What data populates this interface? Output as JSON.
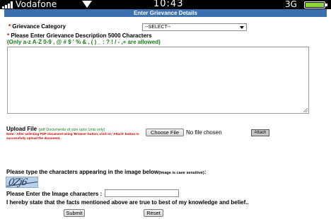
{
  "status_bar": {
    "carrier": "Vodafone",
    "time": "10:43",
    "network": "3G",
    "colors": {
      "battery": "#8cd63a"
    }
  },
  "header": {
    "title": "Enter Grievance Details",
    "color": "#3b6fad"
  },
  "form": {
    "category": {
      "required_mark": "*",
      "label": "Grievance Category",
      "selected": "--SELECT--"
    },
    "description": {
      "required_mark": "*",
      "label": "Please Enter Grievance Description 5000 Characters",
      "hint": "(Only a-z A-Z 0-9 , @ # $ ' % & , ( ) _ : ? ! / - ,+ are allowed)",
      "value": ""
    },
    "upload": {
      "label": "Upload File",
      "label_note": "(pdf Documents of size upto 1mb only)",
      "note": "Note:- After selecting PDF document using 'Browse' button, click on 'Attach' button to successfully upload the document.",
      "choose_button": "Choose File",
      "file_status": "No file chosen",
      "attach_button": "Attach"
    },
    "captcha": {
      "instruction": "Please type the characters appearing in the image below",
      "instruction_note": "(Image is case sensitive)",
      "trailing": ":",
      "image_text": "0Zj6",
      "input_label": "Please Enter the Image characters :",
      "input_value": ""
    },
    "declaration": "I hereby state that the facts mentioned above are true to best of my knowledge and belief..",
    "submit_button": "Submit",
    "reset_button": "Reset"
  }
}
